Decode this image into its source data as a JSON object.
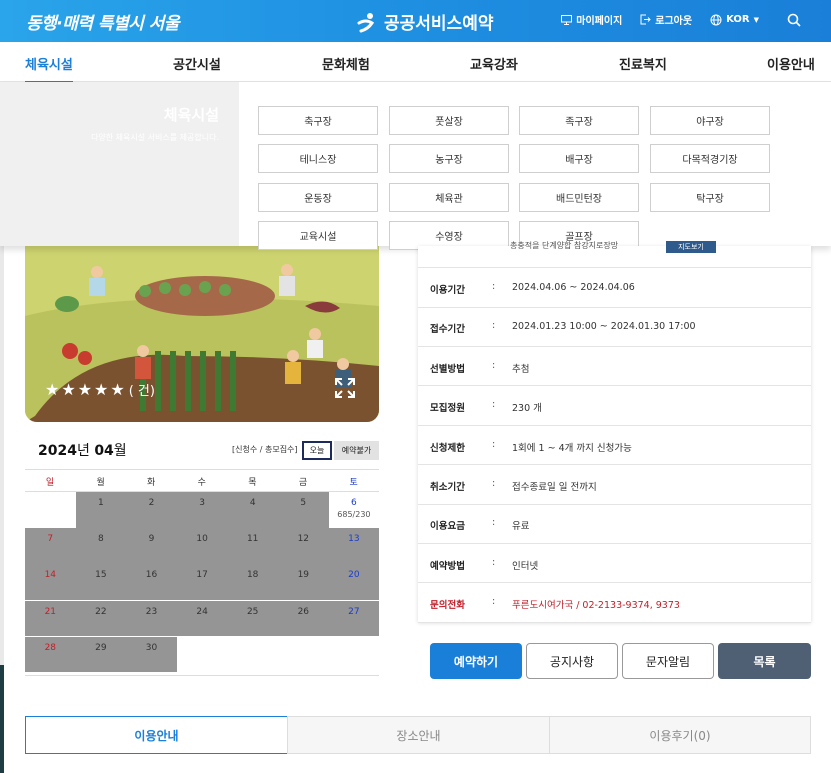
{
  "header": {
    "logo_left": "동행·매력 특별시 서울",
    "brand": "공공서비스예약",
    "links": [
      {
        "label": "마이페이지",
        "icon": "monitor-icon"
      },
      {
        "label": "로그아웃",
        "icon": "logout-icon"
      },
      {
        "label": "KOR",
        "icon": "globe-icon"
      }
    ]
  },
  "gnb": [
    "체육시설",
    "공간시설",
    "문화체험",
    "교육강좌",
    "진료복지",
    "이용안내"
  ],
  "submenu": {
    "title": "체육시설",
    "desc": "다양한 체육시설 서비스를 제공합니다.",
    "items": [
      "축구장",
      "풋살장",
      "족구장",
      "야구장",
      "테니스장",
      "농구장",
      "배구장",
      "다목적경기장",
      "운동장",
      "체육관",
      "배드민턴장",
      "탁구장",
      "교육시설",
      "수영장",
      "골프장"
    ]
  },
  "rating": {
    "stars": 5,
    "count_text": "( 건)"
  },
  "calendar": {
    "year": "2024",
    "year_suffix": "년",
    "month": "04",
    "month_suffix": "월",
    "legend": "[신청수 / 총모집수]",
    "today_label": "오늘",
    "unavailable_label": "예약불가",
    "dows": [
      "일",
      "월",
      "화",
      "수",
      "목",
      "금",
      "토"
    ],
    "weeks": [
      [
        "",
        "1",
        "2",
        "3",
        "4",
        "5",
        "6"
      ],
      [
        "7",
        "8",
        "9",
        "10",
        "11",
        "12",
        "13"
      ],
      [
        "14",
        "15",
        "16",
        "17",
        "18",
        "19",
        "20"
      ],
      [
        "21",
        "22",
        "23",
        "24",
        "25",
        "26",
        "27"
      ],
      [
        "28",
        "29",
        "30",
        "",
        "",
        "",
        ""
      ]
    ],
    "sub_value": "685/230"
  },
  "info": {
    "top_text": "총충적을 단계양합 참강지로장망",
    "top_badge": "지도보기",
    "rows": [
      {
        "k": "이용기간",
        "v": "2024.04.06 ~ 2024.04.06"
      },
      {
        "k": "접수기간",
        "v": "2024.01.23 10:00 ~ 2024.01.30 17:00"
      },
      {
        "k": "선별방법",
        "v": "추첨"
      },
      {
        "k": "모집정원",
        "v": "230 개"
      },
      {
        "k": "신청제한",
        "v": "1회에 1 ~ 4개 까지 신청가능"
      },
      {
        "k": "취소기간",
        "v": "접수종료일 일 전까지"
      },
      {
        "k": "이용요금",
        "v": "유료"
      },
      {
        "k": "예약방법",
        "v": "인터넷"
      },
      {
        "k": "문의전화",
        "v": "푸른도시여가국 / 02-2133-9374, 9373"
      }
    ],
    "colon": ":"
  },
  "actions": {
    "reserve": "예약하기",
    "notice": "공지사항",
    "alert": "문자알림",
    "list": "목록"
  },
  "tabs": [
    "이용안내",
    "장소안내",
    "이용후기(0)"
  ],
  "colors": {
    "primary": "#1a7fd8",
    "dark_button": "#4f5f74",
    "calendar_gray": "#959595"
  }
}
